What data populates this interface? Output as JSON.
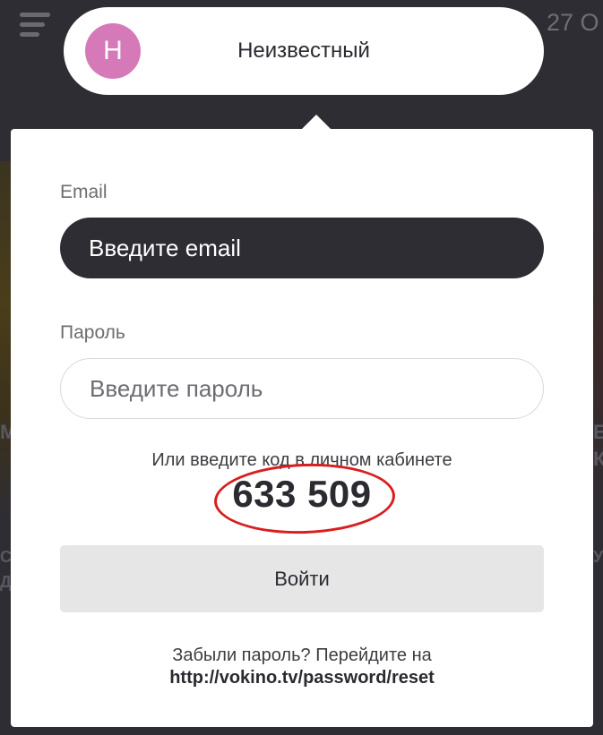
{
  "background": {
    "date_text": "27 О",
    "left_side_text": [
      "М",
      "СТ",
      "ДА"
    ],
    "right_side_text": [
      "Е",
      "К",
      "У"
    ]
  },
  "user": {
    "avatar_letter": "Н",
    "name": "Неизвестный",
    "avatar_color": "#d679b9"
  },
  "login_form": {
    "email_label": "Email",
    "email_placeholder": "Введите email",
    "password_label": "Пароль",
    "password_placeholder": "Введите пароль",
    "code_hint": "Или введите код в личном кабинете",
    "code": "633 509",
    "login_button": "Войти",
    "forgot_text": "Забыли пароль? Перейдите на",
    "reset_link": "http://vokino.tv/password/reset"
  },
  "colors": {
    "dark": "#2e2d33",
    "highlight_circle": "#d81e1e"
  }
}
